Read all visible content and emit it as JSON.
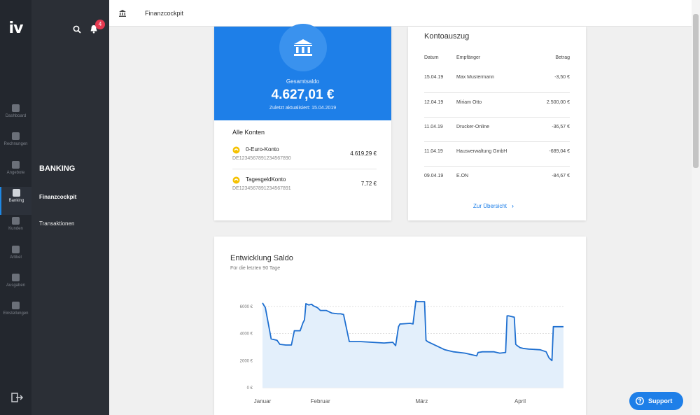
{
  "app": {
    "logo": "iv",
    "notification_count": "4"
  },
  "rail": [
    {
      "label": "Dashboard",
      "icon": "dashboard-icon"
    },
    {
      "label": "Rechnungen",
      "icon": "invoice-icon"
    },
    {
      "label": "Angebote",
      "icon": "offer-icon"
    },
    {
      "label": "Banking",
      "icon": "bank-icon",
      "active": true
    },
    {
      "label": "Kunden",
      "icon": "customers-icon"
    },
    {
      "label": "Artikel",
      "icon": "tag-icon"
    },
    {
      "label": "Ausgaben",
      "icon": "expenses-icon"
    },
    {
      "label": "Einstellungen",
      "icon": "gear-icon"
    }
  ],
  "subnav": {
    "section": "BANKING",
    "items": [
      {
        "label": "Finanzcockpit",
        "active": true
      },
      {
        "label": "Transaktionen",
        "active": false
      }
    ]
  },
  "topbar": {
    "title": "Finanzcockpit"
  },
  "balance": {
    "label": "Gesamtsaldo",
    "amount": "4.627,01 €",
    "updated": "Zuletzt aktualisiert: 15.04.2019"
  },
  "accounts": {
    "title": "Alle Konten",
    "items": [
      {
        "name": "0-Euro-Konto",
        "iban": "DE1234567891234567890",
        "amount": "4.619,29 €"
      },
      {
        "name": "TagesgeldKonto",
        "iban": "DE1234567891234567891",
        "amount": "7,72 €"
      }
    ]
  },
  "statement": {
    "title": "Kontoauszug",
    "headers": {
      "date": "Datum",
      "recipient": "Empfänger",
      "amount": "Betrag"
    },
    "rows": [
      {
        "date": "15.04.19",
        "recipient": "Max Mustermann",
        "amount": "-3,50 €"
      },
      {
        "date": "12.04.19",
        "recipient": "Miriam Otto",
        "amount": "2.500,00 €"
      },
      {
        "date": "11.04.19",
        "recipient": "Drucker-Online",
        "amount": "-36,57 €"
      },
      {
        "date": "11.04.19",
        "recipient": "Hausverwaltung GmbH",
        "amount": "-689,04 €"
      },
      {
        "date": "09.04.19",
        "recipient": "E.ON",
        "amount": "-84,67 €"
      }
    ],
    "link": "Zur Übersicht"
  },
  "chart": {
    "title": "Entwicklung Saldo",
    "subtitle": "Für die letzten 90 Tage"
  },
  "chart_data": {
    "type": "area",
    "title": "Entwicklung Saldo",
    "subtitle": "Für die letzten 90 Tage",
    "y_ticks": [
      "0 €",
      "2000 €",
      "4000 €",
      "6000 €"
    ],
    "y_tick_values": [
      0,
      2000,
      4000,
      6000
    ],
    "ylim": [
      0,
      6400
    ],
    "xlim": [
      0,
      104
    ],
    "x_ticks": [
      "Januar",
      "Februar",
      "März",
      "April"
    ],
    "x_tick_values": [
      0,
      20,
      55,
      89
    ],
    "grid": true,
    "line_color": "#1e6fd0",
    "fill_color": "#e3effb",
    "series": [
      {
        "x": [
          0,
          1,
          3,
          5,
          6,
          8,
          10,
          11,
          13,
          14,
          14.5,
          15,
          16,
          17,
          17.5,
          19,
          20,
          22,
          24,
          26,
          27,
          28,
          30,
          34,
          38,
          42,
          45,
          46,
          47,
          47.5,
          48,
          51,
          52,
          53,
          53.5,
          56,
          56.5,
          57,
          60,
          63,
          66,
          70,
          73,
          74,
          74.5,
          76,
          80,
          82,
          84,
          84.5,
          85,
          87,
          87.5,
          88,
          89,
          90,
          92,
          96,
          98,
          99,
          100,
          100.5,
          102,
          104
        ],
        "y": [
          6250,
          5900,
          3600,
          3500,
          3200,
          3150,
          3150,
          4200,
          4200,
          4800,
          5000,
          6200,
          6100,
          6150,
          6050,
          5900,
          5700,
          5700,
          5500,
          5450,
          5450,
          5400,
          3400,
          3400,
          3350,
          3300,
          3350,
          3100,
          4500,
          4700,
          4700,
          4750,
          4700,
          6400,
          6350,
          6350,
          3500,
          3400,
          3100,
          2800,
          2650,
          2550,
          2400,
          2350,
          2600,
          2650,
          2650,
          2550,
          2600,
          5300,
          5300,
          5200,
          3200,
          3100,
          2950,
          2900,
          2850,
          2800,
          2650,
          2200,
          2000,
          4500,
          4500,
          4500
        ]
      }
    ]
  },
  "support": {
    "label": "Support"
  }
}
